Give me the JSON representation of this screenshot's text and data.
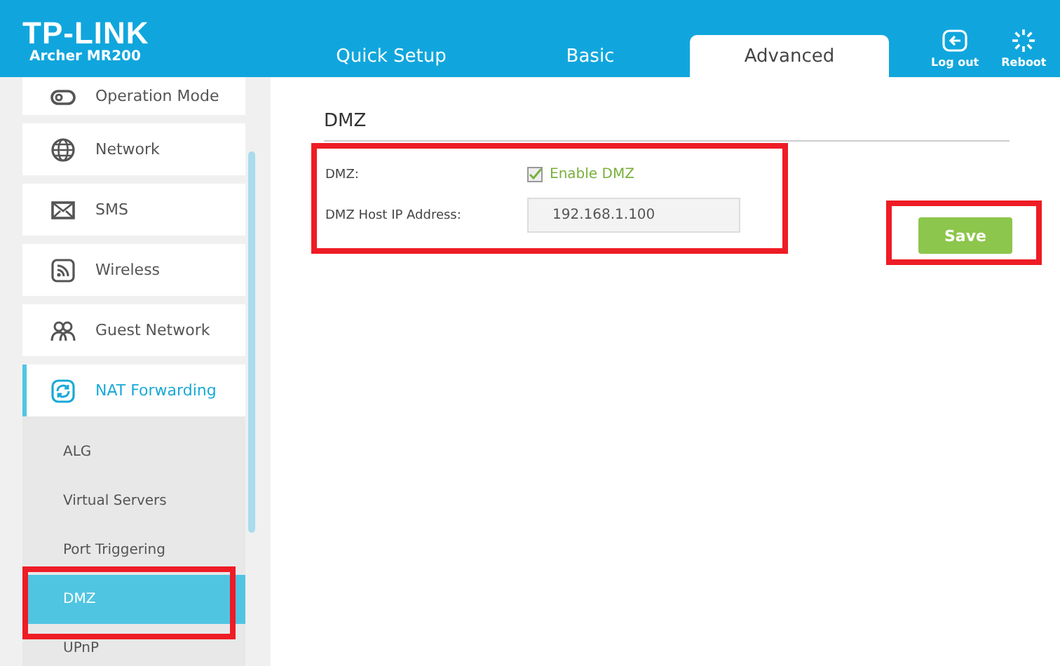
{
  "header": {
    "brand": "TP-LINK",
    "model": "Archer MR200"
  },
  "tabs": [
    {
      "label": "Quick Setup",
      "selected": false
    },
    {
      "label": "Basic",
      "selected": false
    },
    {
      "label": "Advanced",
      "selected": true
    }
  ],
  "actions": [
    {
      "kind": "logout",
      "label": "Log out"
    },
    {
      "kind": "reboot",
      "label": "Reboot"
    }
  ],
  "sidebar": {
    "items": [
      {
        "kind": "mode",
        "label": "Operation Mode",
        "selected": false
      },
      {
        "kind": "globe",
        "label": "Network",
        "selected": false
      },
      {
        "kind": "mail",
        "label": "SMS",
        "selected": false
      },
      {
        "kind": "wifi",
        "label": "Wireless",
        "selected": false
      },
      {
        "kind": "guests",
        "label": "Guest Network",
        "selected": false
      },
      {
        "kind": "nat",
        "label": "NAT Forwarding",
        "selected": true,
        "expanded": true,
        "children": [
          {
            "label": "ALG",
            "selected": false,
            "highlighted": false
          },
          {
            "label": "Virtual Servers",
            "selected": false,
            "highlighted": false
          },
          {
            "label": "Port Triggering",
            "selected": false,
            "highlighted": false
          },
          {
            "label": "DMZ",
            "selected": true,
            "highlighted": true
          },
          {
            "label": "UPnP",
            "selected": false,
            "highlighted": false
          }
        ]
      }
    ]
  },
  "content": {
    "title": "DMZ",
    "form_highlighted": true,
    "dmz_label": "DMZ:",
    "enable": {
      "label": "Enable DMZ",
      "checked": true
    },
    "ip_label": "DMZ Host IP Address:",
    "ip_value": "192.168.1.100",
    "save": {
      "label": "Save",
      "highlighted": true
    }
  }
}
